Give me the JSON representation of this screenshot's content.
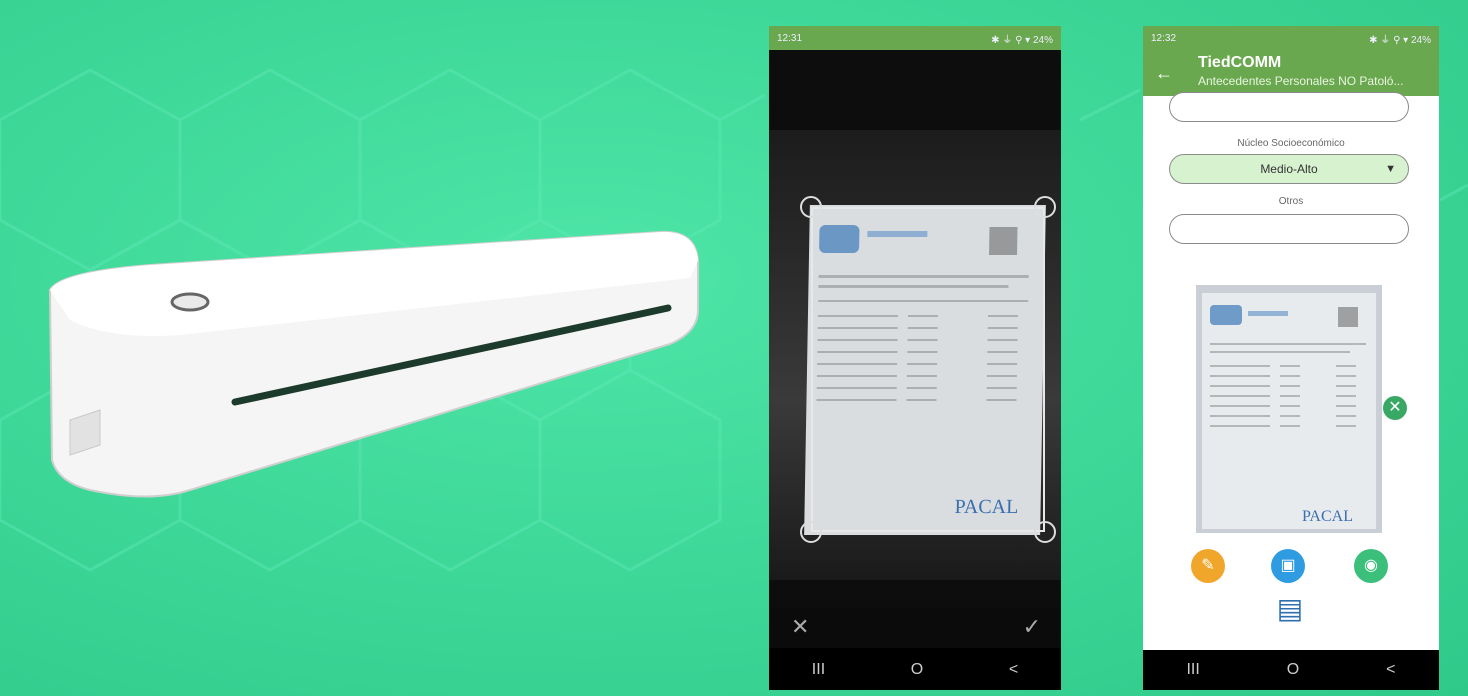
{
  "phone_scan": {
    "status": {
      "time": "12:31",
      "indicators": "✱ ⏚ ⚲ ▾ 24%"
    },
    "controls": {
      "cancel_icon": "close-icon",
      "confirm_icon": "check-icon"
    },
    "nav": {
      "recent": "III",
      "home": "O",
      "back": "<"
    }
  },
  "phone_app": {
    "status": {
      "time": "12:32",
      "indicators": "✱ ⏚ ⚲ ▾ 24%"
    },
    "appbar": {
      "title": "TiedCOMM",
      "subtitle": "Antecedentes Personales NO Patoló..."
    },
    "form": {
      "socio_label": "Núcleo Socioeconómico",
      "socio_value": "Medio-Alto",
      "otros_label": "Otros"
    },
    "document_brand": "PACAL",
    "actions": {
      "attach_icon": "paperclip-icon",
      "gallery_icon": "image-icon",
      "camera_icon": "camera-icon",
      "save_icon": "save-icon"
    },
    "nav": {
      "recent": "III",
      "home": "O",
      "back": "<"
    }
  },
  "colors": {
    "background": "#3fd99a",
    "appbar": "#6aa84f",
    "select": "#d7f2cf"
  }
}
